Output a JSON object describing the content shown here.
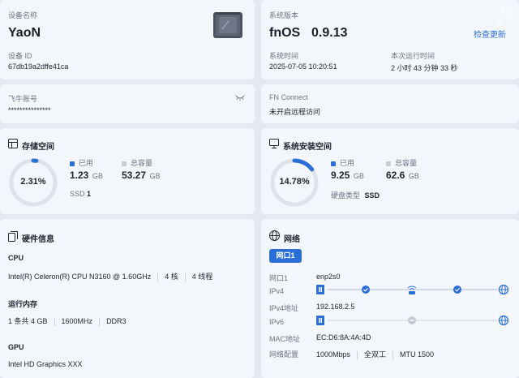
{
  "device": {
    "name_label": "设备名称",
    "name": "YaoN",
    "id_label": "设备 ID",
    "id": "67db19a2dffe41ca"
  },
  "system": {
    "version_label": "系统版本",
    "os_name": "fnOS",
    "os_version": "0.9.13",
    "check_update": "检查更新",
    "time_label": "系统时间",
    "time": "2025-07-05 10:20:51",
    "uptime_label": "本次运行时间",
    "uptime": "2 小时 43 分钟 33 秒"
  },
  "account": {
    "label": "飞牛账号",
    "value": "***************"
  },
  "fn_connect": {
    "label": "FN Connect",
    "value": "未开启远程访问"
  },
  "storage": {
    "title": "存储空间",
    "percent_text": "2.31%",
    "percent": 2.31,
    "used_label": "已用",
    "used_value": "1.23",
    "used_unit": "GB",
    "total_label": "总容量",
    "total_value": "53.27",
    "total_unit": "GB",
    "disk_type": "SSD",
    "disk_count": "1",
    "used_color": "#2b6fd6",
    "total_color": "#c8ced8"
  },
  "sys_storage": {
    "title": "系统安装空间",
    "percent_text": "14.78%",
    "percent": 14.78,
    "used_label": "已用",
    "used_value": "9.25",
    "used_unit": "GB",
    "total_label": "总容量",
    "total_value": "62.6",
    "total_unit": "GB",
    "disk_type_label": "硬盘类型",
    "disk_type": "SSD"
  },
  "hardware": {
    "title": "硬件信息",
    "cpu_label": "CPU",
    "cpu_model": "Intel(R) Celeron(R) CPU N3160 @ 1.60GHz",
    "cpu_cores": "4 核",
    "cpu_threads": "4 线程",
    "ram_label": "运行内存",
    "ram_count": "1 条共 4 GB",
    "ram_freq": "1600MHz",
    "ram_type": "DDR3",
    "gpu_label": "GPU",
    "gpu_model": "Intel HD Graphics XXX"
  },
  "network": {
    "title": "网络",
    "tab": "网口1",
    "port_label": "网口1",
    "port_value": "enp2s0",
    "ipv4_label": "IPv4",
    "ipv4_addr_label": "IPv4地址",
    "ipv4_addr": "192.168.2.5",
    "ipv6_label": "IPv6",
    "mac_label": "MAC地址",
    "mac": "EC:D6:8A:4A:4D",
    "config_label": "网络配置",
    "speed": "1000Mbps",
    "duplex": "全双工",
    "mtu": "MTU 1500",
    "accent": "#2b6fd6"
  }
}
